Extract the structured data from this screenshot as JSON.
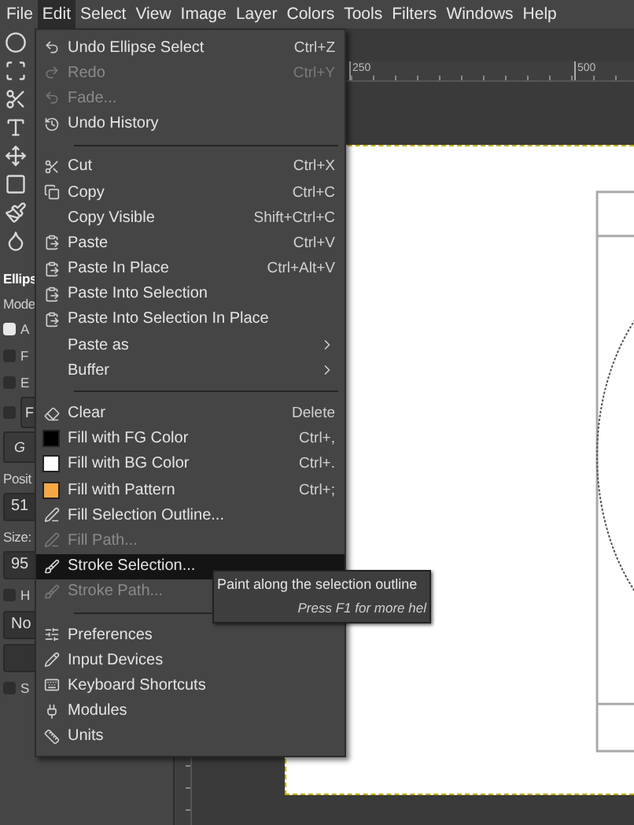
{
  "menubar": [
    {
      "label": "File",
      "selected": false
    },
    {
      "label": "Edit",
      "selected": true
    },
    {
      "label": "Select",
      "selected": false
    },
    {
      "label": "View",
      "selected": false
    },
    {
      "label": "Image",
      "selected": false
    },
    {
      "label": "Layer",
      "selected": false
    },
    {
      "label": "Colors",
      "selected": false
    },
    {
      "label": "Tools",
      "selected": false
    },
    {
      "label": "Filters",
      "selected": false
    },
    {
      "label": "Windows",
      "selected": false
    },
    {
      "label": "Help",
      "selected": false
    }
  ],
  "tool_options": [
    {
      "kind": "title",
      "text": "Ellips"
    },
    {
      "kind": "label",
      "text": "Mode"
    },
    {
      "kind": "check",
      "text": "A",
      "checked": true
    },
    {
      "kind": "check",
      "text": "F",
      "checked": false
    },
    {
      "kind": "check",
      "text": "E",
      "checked": false
    },
    {
      "kind": "boxcheck",
      "text": "F",
      "checked": false
    },
    {
      "kind": "box",
      "text": "G"
    },
    {
      "kind": "label",
      "text": "Posit"
    },
    {
      "kind": "field",
      "text": "51"
    },
    {
      "kind": "label",
      "text": "Size:"
    },
    {
      "kind": "field",
      "text": "95"
    },
    {
      "kind": "check",
      "text": "H",
      "checked": false
    },
    {
      "kind": "field",
      "text": "No"
    },
    {
      "kind": "blank"
    },
    {
      "kind": "check",
      "text": "S",
      "checked": false
    }
  ],
  "ruler": {
    "labels": [
      "250",
      "500"
    ]
  },
  "edit_menu": [
    {
      "kind": "item",
      "label": "Undo Ellipse Select",
      "shortcut": "Ctrl+Z",
      "disabled": false,
      "selected": false
    },
    {
      "kind": "item",
      "label": "Redo",
      "shortcut": "Ctrl+Y",
      "disabled": true,
      "selected": false
    },
    {
      "kind": "item",
      "label": "Fade...",
      "disabled": true,
      "selected": false
    },
    {
      "kind": "item",
      "label": "Undo History",
      "disabled": false,
      "selected": false
    },
    {
      "kind": "separator"
    },
    {
      "kind": "item",
      "label": "Cut",
      "shortcut": "Ctrl+X",
      "disabled": false,
      "selected": false
    },
    {
      "kind": "item",
      "label": "Copy",
      "shortcut": "Ctrl+C",
      "disabled": false,
      "selected": false
    },
    {
      "kind": "item",
      "label": "Copy Visible",
      "shortcut": "Shift+Ctrl+C",
      "disabled": false,
      "selected": false
    },
    {
      "kind": "item",
      "label": "Paste",
      "shortcut": "Ctrl+V",
      "disabled": false,
      "selected": false
    },
    {
      "kind": "item",
      "label": "Paste In Place",
      "shortcut": "Ctrl+Alt+V",
      "disabled": false,
      "selected": false
    },
    {
      "kind": "item",
      "label": "Paste Into Selection",
      "disabled": false,
      "selected": false
    },
    {
      "kind": "item",
      "label": "Paste Into Selection In Place",
      "disabled": false,
      "selected": false
    },
    {
      "kind": "item",
      "label": "Paste as",
      "submenu": true,
      "disabled": false,
      "selected": false
    },
    {
      "kind": "item",
      "label": "Buffer",
      "submenu": true,
      "disabled": false,
      "selected": false
    },
    {
      "kind": "separator"
    },
    {
      "kind": "item",
      "label": "Clear",
      "shortcut": "Delete",
      "disabled": false,
      "selected": false
    },
    {
      "kind": "item",
      "label": "Fill with FG Color",
      "shortcut": "Ctrl+,",
      "color": "#000000",
      "disabled": false,
      "selected": false
    },
    {
      "kind": "item",
      "label": "Fill with BG Color",
      "shortcut": "Ctrl+.",
      "color": "#ffffff",
      "disabled": false,
      "selected": false
    },
    {
      "kind": "item",
      "label": "Fill with Pattern",
      "shortcut": "Ctrl+;",
      "color": "#f5a742",
      "disabled": false,
      "selected": false
    },
    {
      "kind": "item",
      "label": "Fill Selection Outline...",
      "disabled": false,
      "selected": false
    },
    {
      "kind": "item",
      "label": "Fill Path...",
      "disabled": true,
      "selected": false
    },
    {
      "kind": "item",
      "label": "Stroke Selection...",
      "disabled": false,
      "selected": true
    },
    {
      "kind": "item",
      "label": "Stroke Path...",
      "disabled": true,
      "selected": false
    },
    {
      "kind": "separator"
    },
    {
      "kind": "item",
      "label": "Preferences",
      "disabled": false,
      "selected": false
    },
    {
      "kind": "item",
      "label": "Input Devices",
      "disabled": false,
      "selected": false
    },
    {
      "kind": "item",
      "label": "Keyboard Shortcuts",
      "disabled": false,
      "selected": false
    },
    {
      "kind": "item",
      "label": "Modules",
      "disabled": false,
      "selected": false
    },
    {
      "kind": "item",
      "label": "Units",
      "disabled": false,
      "selected": false
    }
  ],
  "tooltip": {
    "text": "Paint along the selection outline",
    "hint": "Press F1 for more hel"
  }
}
